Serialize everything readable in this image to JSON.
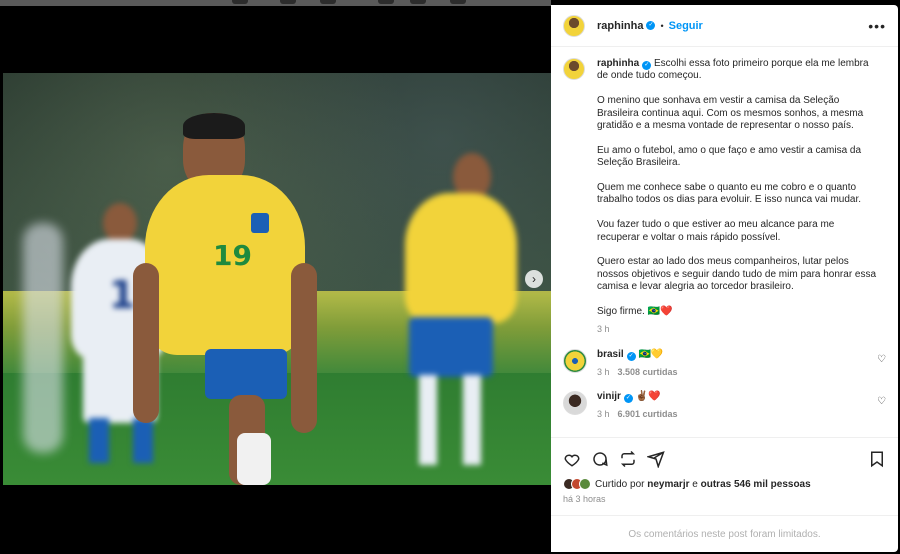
{
  "post": {
    "username": "raphinha",
    "separator": "•",
    "follow_label": "Seguir",
    "more_label": "•••",
    "carousel_next": "›",
    "caption_paragraphs": [
      "Escolhi essa foto primeiro porque ela me lembra de onde tudo começou.",
      "O menino que sonhava em vestir a camisa da Seleção Brasileira continua aqui. Com os mesmos sonhos, a mesma gratidão e a mesma vontade de representar o nosso país.",
      "Eu amo o futebol, amo o que faço e amo vestir a camisa da Seleção Brasileira.",
      "Quem me conhece sabe o quanto eu me cobro e o quanto trabalho todos os dias para evoluir. E isso nunca vai mudar.",
      "Vou fazer tudo o que estiver ao meu alcance para me recuperar e voltar o mais rápido possível.",
      "Quero estar ao lado dos meus companheiros, lutar pelos nossos objetivos e seguir dando tudo de mim para honrar essa camisa e levar alegria ao torcedor brasileiro.",
      "Sigo firme. 🇧🇷❤️"
    ],
    "caption_time": "3 h",
    "likes_user": "neymarjr",
    "likes_prefix": "Curtido por",
    "likes_conjunction": "e",
    "likes_rest": "outras 546 mil pessoas",
    "posted_ago": "há 3 horas",
    "comments_limited": "Os comentários neste post foram limitados."
  },
  "comments": [
    {
      "user": "brasil",
      "text": "🇧🇷💛",
      "time": "3 h",
      "likes": "3.508 curtidas"
    },
    {
      "user": "vinijr",
      "text": "✌🏾❤️",
      "time": "3 h",
      "likes": "6.901 curtidas"
    }
  ],
  "photo": {
    "jersey_number": "19",
    "back_number": "10"
  },
  "icons": [
    "heart-icon",
    "comment-icon",
    "repost-icon",
    "share-icon",
    "bookmark-icon"
  ],
  "colors": {
    "accent": "#0095f6",
    "secondary_text": "#8e8e8e",
    "jersey_yellow": "#f2d33a",
    "shorts_blue": "#1b5fb5"
  }
}
